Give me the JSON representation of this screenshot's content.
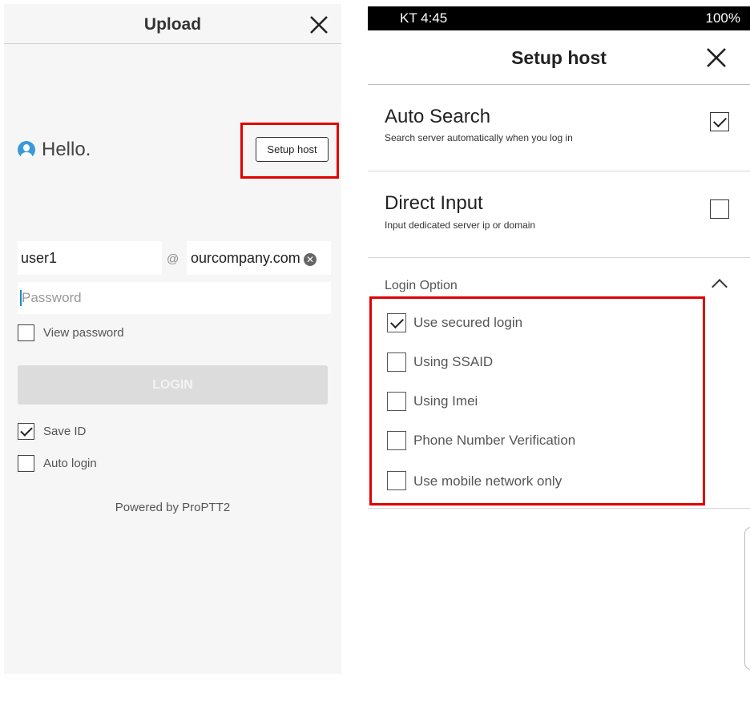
{
  "left": {
    "title": "Upload",
    "close_icon": "close-icon",
    "greeting": "Hello.",
    "setup_host_button": "Setup host",
    "user_id_value": "user1",
    "at_sign": "@",
    "domain_value": "ourcompany.com",
    "clear_icon_glyph": "✕",
    "password_placeholder": "Password",
    "view_password_label": "View password",
    "login_button": "LOGIN",
    "save_id_label": "Save ID",
    "auto_login_label": "Auto login",
    "powered_by": "Powered by ProPTT2"
  },
  "right": {
    "status_left": "KT 4:45",
    "status_right": "100%",
    "title": "Setup host",
    "auto_search": {
      "title": "Auto Search",
      "subtitle": "Search server automatically when you log in",
      "checked": true
    },
    "direct_input": {
      "title": "Direct Input",
      "subtitle": "Input dedicated server ip or domain",
      "checked": false
    },
    "login_option_title": "Login Option",
    "login_options": [
      {
        "label": "Use secured login",
        "checked": true
      },
      {
        "label": "Using SSAID",
        "checked": false
      },
      {
        "label": "Using Imei",
        "checked": false
      },
      {
        "label": "Phone Number Verification",
        "checked": false
      },
      {
        "label": "Use mobile network only",
        "checked": false
      }
    ]
  },
  "colors": {
    "highlight": "#e00000",
    "avatar": "#3a9ad8",
    "login_disabled": "#dcdcdc"
  }
}
